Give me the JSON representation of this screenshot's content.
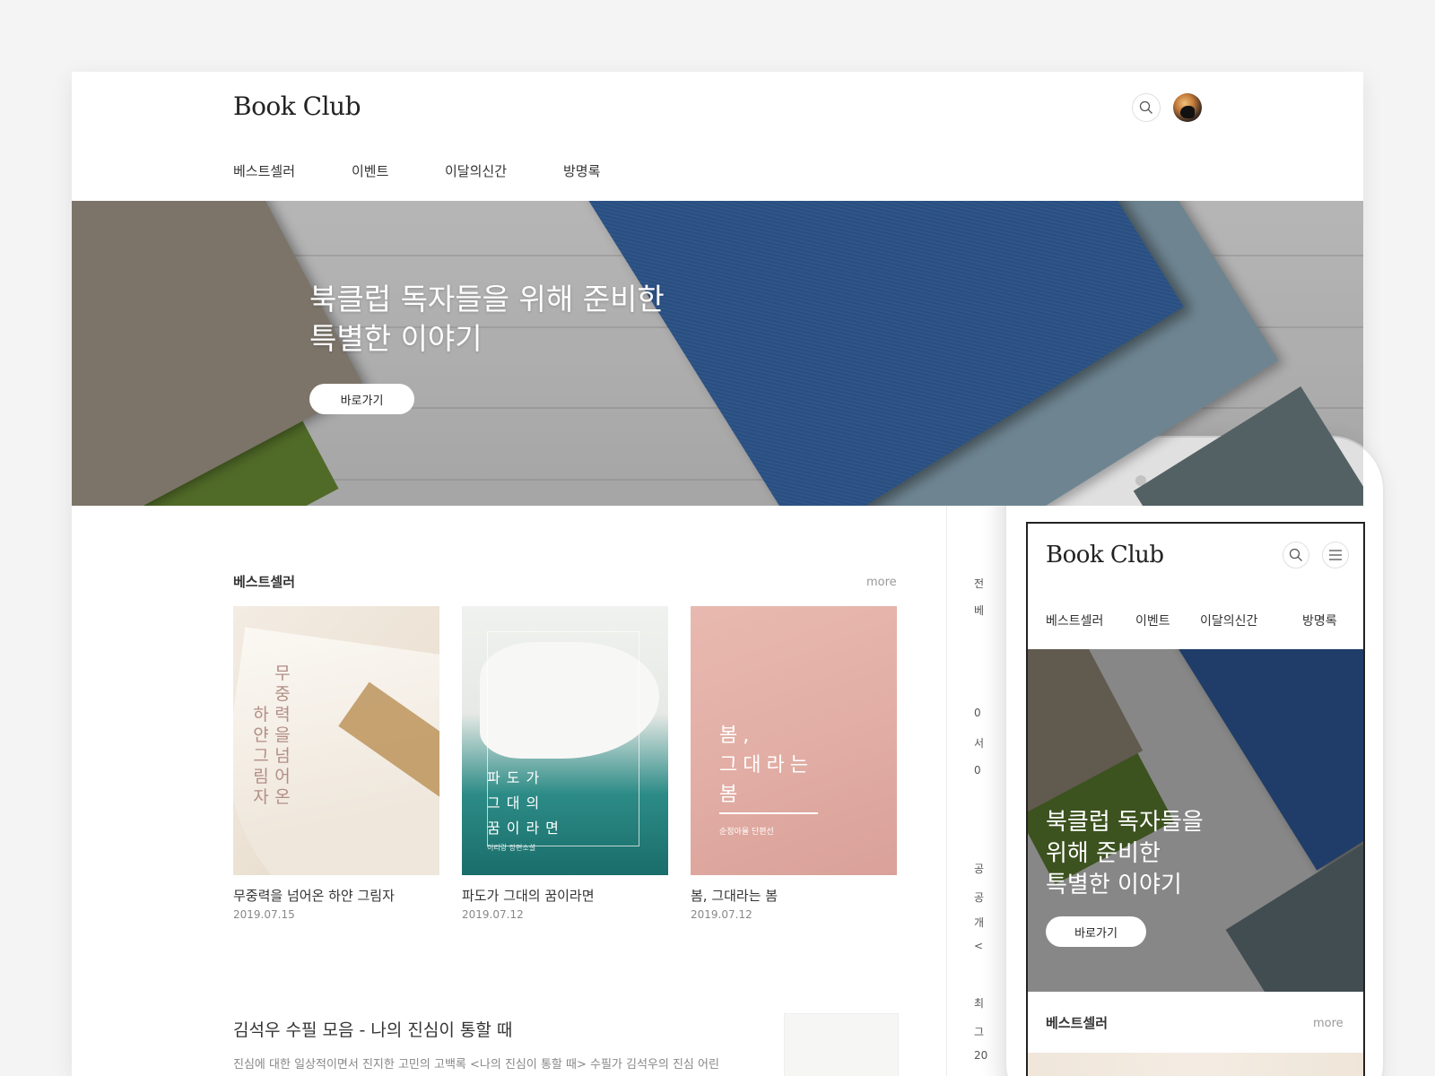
{
  "desktop": {
    "logo": "Book Club",
    "nav": [
      "베스트셀러",
      "이벤트",
      "이달의신간",
      "방명록"
    ],
    "hero": {
      "title": "북클럽 독자들을 위해 준비한\n특별한 이야기",
      "button": "바로가기"
    },
    "bestseller": {
      "title": "베스트셀러",
      "more": "more",
      "books": [
        {
          "title": "무중력을 넘어온 하얀 그림자",
          "date": "2019.07.15",
          "cover_col1": "무중력을넘어온",
          "cover_col2": "하얀그림자"
        },
        {
          "title": "파도가 그대의 꿈이라면",
          "date": "2019.07.12",
          "cover_text": "파도가\n그대의\n꿈이라면",
          "cover_author": "이리랑 장편소설"
        },
        {
          "title": "봄, 그대라는 봄",
          "date": "2019.07.12",
          "cover_text": "봄,\n그대라는\n봄",
          "cover_sub": "순정아율 단편선"
        }
      ]
    },
    "article": {
      "title": "김석우 수필 모음 - 나의 진심이 통할 때",
      "desc": "진심에 대한 일상적이면서 진지한 고민의 고백록 <나의 진심이 통할 때> 수필가 김석우의 진심 어린"
    },
    "sidebar_fragments": [
      "전",
      "베",
      "0",
      "서",
      "0",
      "공",
      "공",
      "개",
      "<",
      "최",
      "그",
      "20"
    ]
  },
  "mobile": {
    "logo": "Book Club",
    "nav": [
      "베스트셀러",
      "이벤트",
      "이달의신간",
      "방명록"
    ],
    "hero": {
      "title": "북클럽 독자들을\n위해 준비한\n특별한 이야기",
      "button": "바로가기"
    },
    "bestseller": {
      "title": "베스트셀러",
      "more": "more"
    }
  },
  "icons": {
    "search": "search-icon",
    "menu": "hamburger-menu-icon",
    "avatar": "avatar"
  },
  "colors": {
    "background": "#f4f4f4",
    "text": "#222222",
    "muted": "#888888"
  }
}
